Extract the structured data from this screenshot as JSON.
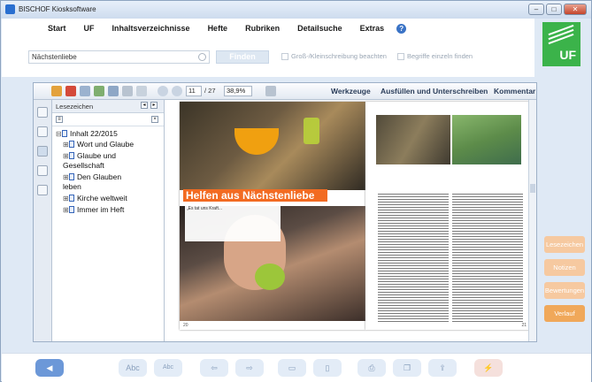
{
  "window": {
    "title": "BISCHOF Kiosksoftware"
  },
  "menu": {
    "items": [
      "Start",
      "UF",
      "Inhaltsverzeichnisse",
      "Hefte",
      "Rubriken",
      "Detailsuche",
      "Extras"
    ]
  },
  "search": {
    "value": "Nächstenliebe",
    "find_label": "Finden",
    "option1": "Groß-/Kleinschreibung beachten",
    "option2": "Begriffe einzeln finden"
  },
  "logo": {
    "text": "UF"
  },
  "toolbar": {
    "current_page": "11",
    "total_pages": "/ 27",
    "zoom": "38,9%",
    "werkzeuge": "Werkzeuge",
    "ausfuellen": "Ausfüllen und Unterschreiben",
    "kommentar": "Kommentar"
  },
  "bookmarks": {
    "title": "Lesezeichen",
    "root": "Inhalt 22/2015",
    "items": [
      "Wort und Glaube",
      "Glaube und Gesellschaft",
      "Den Glauben leben",
      "Kirche weltweit",
      "Immer im Heft"
    ]
  },
  "article": {
    "headline": "Helfen aus Nächstenliebe",
    "quote": "„Es tat uns Kraft..."
  },
  "right_tabs": [
    "Lesezeichen",
    "Notizen",
    "Bewertungen",
    "Verlauf"
  ],
  "bottom": {
    "abc1": "Abc",
    "abc2": "Abc"
  },
  "colors": {
    "accent": "#f26b22",
    "logo_green": "#3bb34a",
    "nav_blue": "#6c98d8"
  }
}
